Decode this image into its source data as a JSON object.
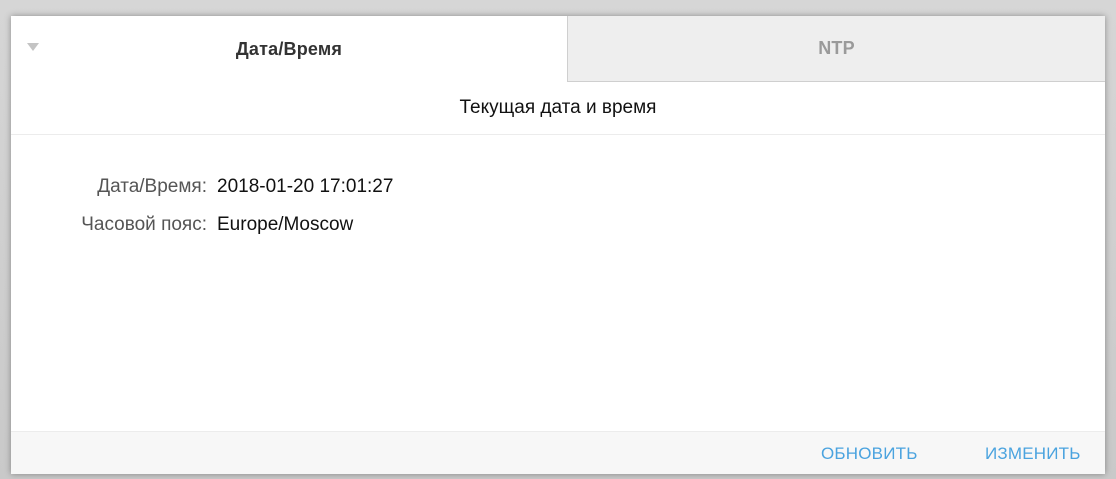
{
  "tabs": [
    {
      "label": "Дата/Время",
      "active": true
    },
    {
      "label": "NTP",
      "active": false
    }
  ],
  "section": {
    "title": "Текущая дата и время"
  },
  "info": {
    "rows": [
      {
        "label": "Дата/Время:",
        "value": "2018-01-20 17:01:27"
      },
      {
        "label": "Часовой пояс:",
        "value": "Europe/Moscow"
      }
    ]
  },
  "footer": {
    "refresh_label": "ОБНОВИТЬ",
    "edit_label": "ИЗМЕНИТЬ"
  },
  "colors": {
    "accent": "#4aa3df",
    "inactive_tab_bg": "#eeeeee",
    "footer_bg": "#f7f7f7"
  },
  "icons": {
    "collapse": "chevron-down-icon"
  }
}
